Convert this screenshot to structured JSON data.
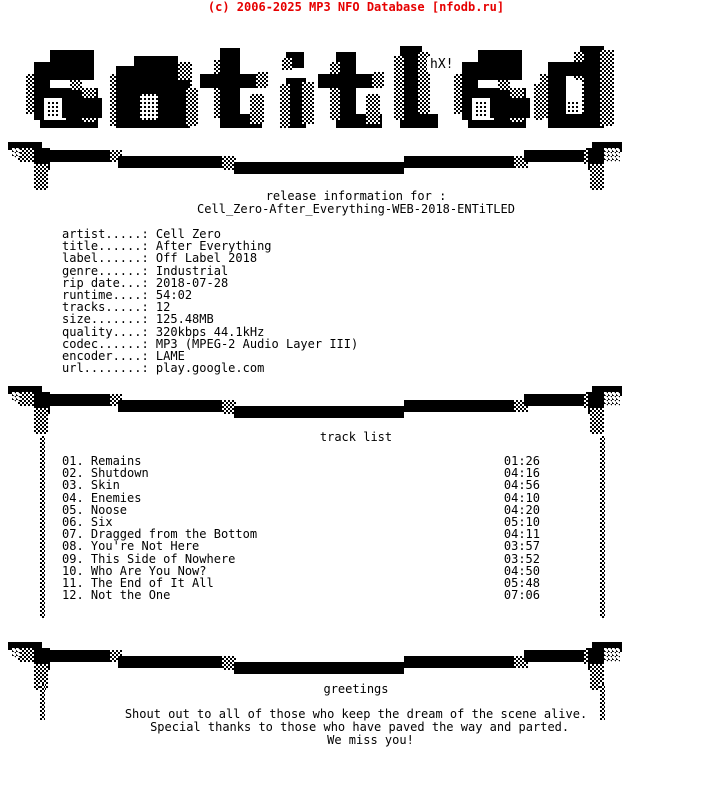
{
  "header": {
    "copyright": "(c) 2006-2025 MP3 NFO Database [nfodb.ru]",
    "copyright_color": "#e60000",
    "logo_text": "entitled",
    "logo_tag": "hX!",
    "logo_ascii": "    ▄███▄      ▄▄      ▄▄              ▄▄                ▄▄\n  ▄██▀ ▀██▄  ▄██▀█▄  ▀██▄     ▄█▀    ▄██▀ ▀██▄   ▄███▄   ▀██▄\n ▐██    ██▌ ▐██  ██▌  ██▌    ▐█▌    ▐██     ██▌ ▐██ ██▌   ██▌\n  ▀██▄▄██▀   ▀█████   ▀██▄▄  ▀█▄▄    ▀██▄▄▄██▀   ▀███▀  ▄██▀"
  },
  "sections": {
    "release": {
      "heading_line1": "release information for :",
      "heading_line2": "Cell_Zero-After_Everything-WEB-2018-ENTiTLED",
      "fields": [
        {
          "label": "artist.....:",
          "value": "Cell Zero"
        },
        {
          "label": "title......:",
          "value": "After Everything"
        },
        {
          "label": "label......:",
          "value": "Off Label 2018"
        },
        {
          "label": "genre......:",
          "value": "Industrial"
        },
        {
          "label": "rip date...:",
          "value": "2018-07-28"
        },
        {
          "label": "runtime....:",
          "value": "54:02"
        },
        {
          "label": "tracks.....:",
          "value": "12"
        },
        {
          "label": "size.......:",
          "value": "125.48MB"
        },
        {
          "label": "quality....:",
          "value": "320kbps 44.1kHz"
        },
        {
          "label": "codec......:",
          "value": "MP3 (MPEG-2 Audio Layer III)"
        },
        {
          "label": "encoder....:",
          "value": "LAME"
        },
        {
          "label": "url........:",
          "value": "play.google.com"
        }
      ]
    },
    "tracklist": {
      "heading": "track list",
      "tracks": [
        {
          "num": "01.",
          "title": "Remains",
          "time": "01:26"
        },
        {
          "num": "02.",
          "title": "Shutdown",
          "time": "04:16"
        },
        {
          "num": "03.",
          "title": "Skin",
          "time": "04:56"
        },
        {
          "num": "04.",
          "title": "Enemies",
          "time": "04:10"
        },
        {
          "num": "05.",
          "title": "Noose",
          "time": "04:20"
        },
        {
          "num": "06.",
          "title": "Six",
          "time": "05:10"
        },
        {
          "num": "07.",
          "title": "Dragged from the Bottom",
          "time": "04:11"
        },
        {
          "num": "08.",
          "title": "You're Not Here",
          "time": "03:57"
        },
        {
          "num": "09.",
          "title": "This Side of Nowhere",
          "time": "03:52"
        },
        {
          "num": "10.",
          "title": "Who Are You Now?",
          "time": "04:50"
        },
        {
          "num": "11.",
          "title": "The End of It All",
          "time": "05:48"
        },
        {
          "num": "12.",
          "title": "Not the One",
          "time": "07:06"
        }
      ]
    },
    "greetings": {
      "heading": "greetings",
      "line1": "Shout out to all of those who keep the dream of the scene alive.",
      "line2": " Special thanks to those who have paved the way and parted.",
      "line3": "    We miss you!"
    }
  }
}
